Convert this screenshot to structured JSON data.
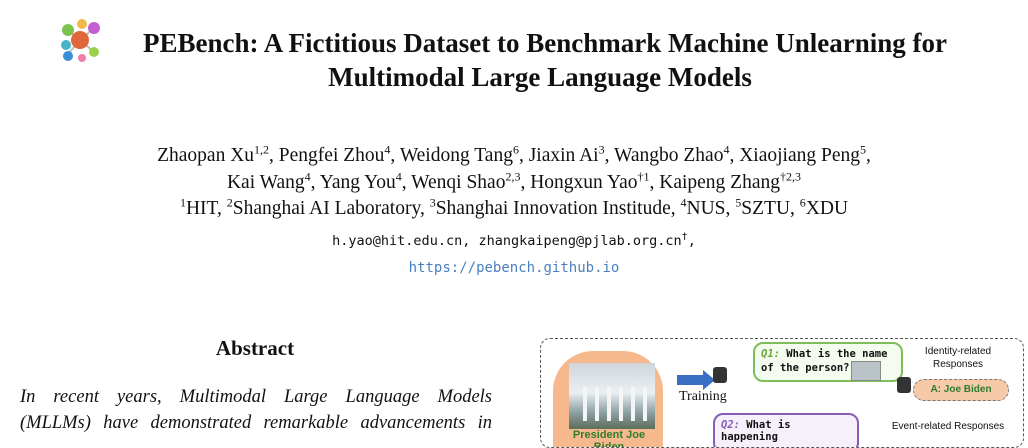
{
  "title": {
    "line1": "PEBench: A Fictitious Dataset to Benchmark Machine Unlearning for",
    "line2": "Multimodal Large Language Models"
  },
  "authors": [
    {
      "name": "Zhaopan Xu",
      "sup": "1,2"
    },
    {
      "name": "Pengfei Zhou",
      "sup": "4"
    },
    {
      "name": "Weidong Tang",
      "sup": "6"
    },
    {
      "name": "Jiaxin Ai",
      "sup": "3"
    },
    {
      "name": "Wangbo Zhao",
      "sup": "4"
    },
    {
      "name": "Xiaojiang Peng",
      "sup": "5"
    },
    {
      "name": "Kai Wang",
      "sup": "4"
    },
    {
      "name": "Yang You",
      "sup": "4"
    },
    {
      "name": "Wenqi Shao",
      "sup": "2,3"
    },
    {
      "name": "Hongxun Yao",
      "sup": "†1"
    },
    {
      "name": "Kaipeng Zhang",
      "sup": "†2,3"
    }
  ],
  "affiliations": [
    {
      "sup": "1",
      "name": "HIT"
    },
    {
      "sup": "2",
      "name": "Shanghai AI Laboratory"
    },
    {
      "sup": "3",
      "name": "Shanghai Innovation Institude"
    },
    {
      "sup": "4",
      "name": "NUS"
    },
    {
      "sup": "5",
      "name": "SZTU"
    },
    {
      "sup": "6",
      "name": "XDU"
    }
  ],
  "emails": {
    "text": "h.yao@hit.edu.cn, zhangkaipeng@pjlab.org.cn",
    "sup": "†",
    "trail": ","
  },
  "url": "https://pebench.github.io",
  "abstract": {
    "heading": "Abstract",
    "lines": [
      "In recent years, Multimodal Large Language Models",
      "(MLLMs) have demonstrated remarkable advancements in"
    ]
  },
  "figure": {
    "person_name": "President Joe Biden",
    "training_label": "Training",
    "q1_tag": "Q1:",
    "q1_text_a": " What is the name",
    "q1_text_b": "of the person?",
    "identity_label_a": "Identity-related",
    "identity_label_b": "Responses",
    "answer": "A: Joe Biden",
    "q2_tag": "Q2:",
    "q2_text": " What is happening",
    "event_label": "Event-related Responses",
    "colors": {
      "green": "#7cbf5a",
      "purple": "#8a5bb8",
      "orange": "#f6b98e",
      "arrow": "#3a6fc4"
    }
  }
}
